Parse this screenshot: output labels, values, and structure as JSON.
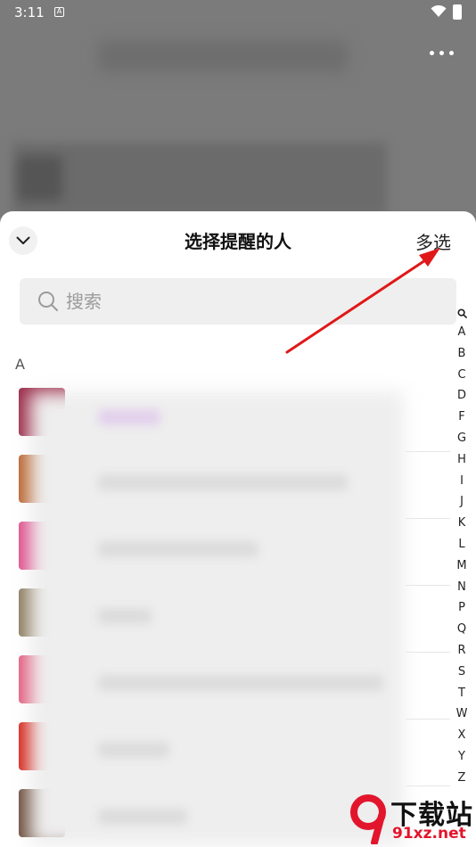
{
  "status_bar": {
    "time": "3:11",
    "notification_badge": "A"
  },
  "sheet": {
    "title": "选择提醒的人",
    "multi_select_label": "多选",
    "search_placeholder": "搜索",
    "section_letter": "A"
  },
  "index_letters": [
    "A",
    "B",
    "C",
    "D",
    "F",
    "G",
    "H",
    "I",
    "J",
    "K",
    "L",
    "M",
    "N",
    "P",
    "Q",
    "R",
    "S",
    "T",
    "W",
    "X",
    "Y",
    "Z"
  ],
  "contacts": [
    {
      "avatar_color": "#9b2a48"
    },
    {
      "avatar_color": "#b8622c"
    },
    {
      "avatar_color": "#e04a8a"
    },
    {
      "avatar_color": "#8b7a5c"
    },
    {
      "avatar_color": "#e35c7e"
    },
    {
      "avatar_color": "#d7241b"
    },
    {
      "avatar_color": "#6b4b3a"
    }
  ],
  "watermark": {
    "brand": "下载站",
    "url": "91xz.net"
  },
  "colors": {
    "annotation_arrow": "#e01818",
    "sheet_bg": "#ffffff",
    "overlay_dim": "#7b7b7b"
  }
}
